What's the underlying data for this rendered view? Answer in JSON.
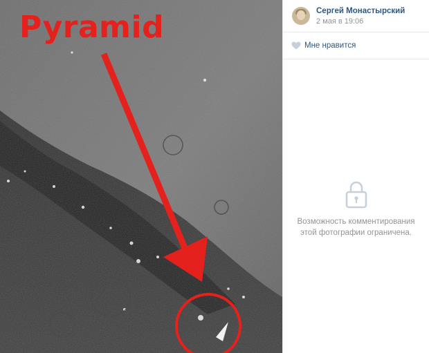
{
  "photo": {
    "overlay_label": "Pyramid",
    "annotation_color": "#e4211c"
  },
  "post": {
    "author_name": "Сергей Монастырский",
    "date": "2 мая в 19:06"
  },
  "actions": {
    "like_label": "Мне нравится"
  },
  "comments": {
    "locked_text": "Возможность комментирования этой фотографии ограничена."
  },
  "icons": {
    "like": "heart-icon",
    "locked": "lock-icon",
    "avatar": "avatar"
  }
}
